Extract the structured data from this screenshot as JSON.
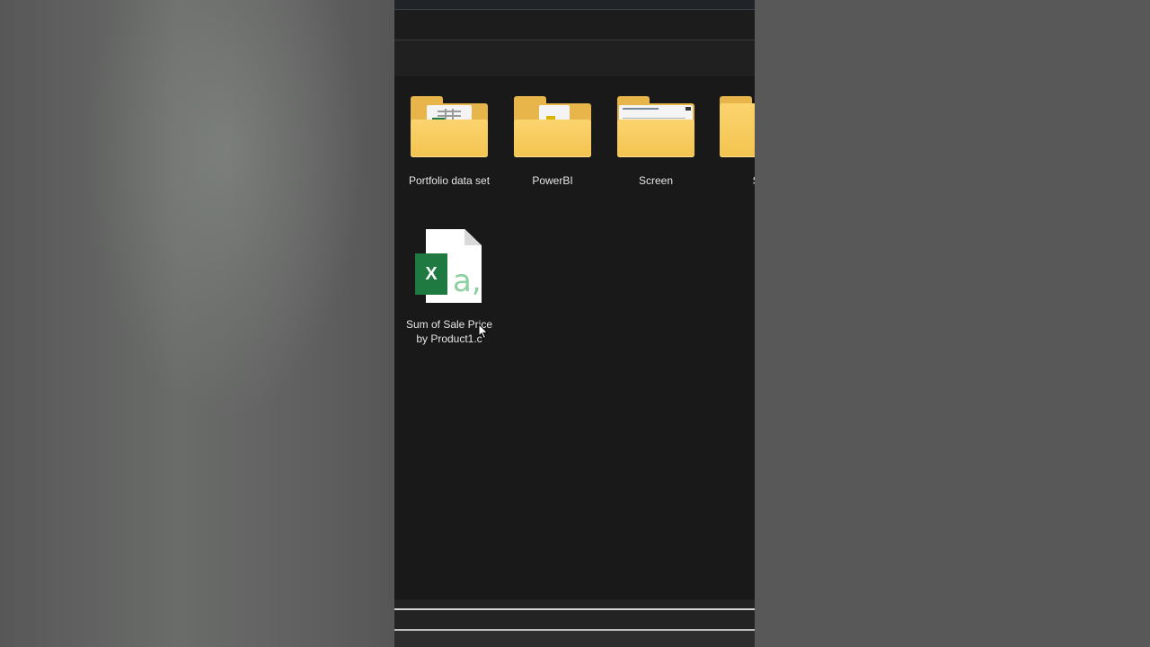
{
  "explorer": {
    "items": [
      {
        "label": "Portfolio data set",
        "icon": "folder-icon"
      },
      {
        "label": "PowerBI",
        "icon": "folder-icon"
      },
      {
        "label": "Screen",
        "icon": "folder-icon"
      },
      {
        "label": "Sh",
        "icon": "folder-icon"
      }
    ],
    "file": {
      "label_line1": "Sum of Sale Price",
      "label_line2": "by Product1.c",
      "icon": "excel-csv-icon",
      "badge": "X",
      "glyph": "a,"
    }
  },
  "colors": {
    "folder_front": "#f3c450",
    "folder_back": "#e8b54a",
    "excel_green": "#1f7a42",
    "window_bg": "#191919"
  }
}
